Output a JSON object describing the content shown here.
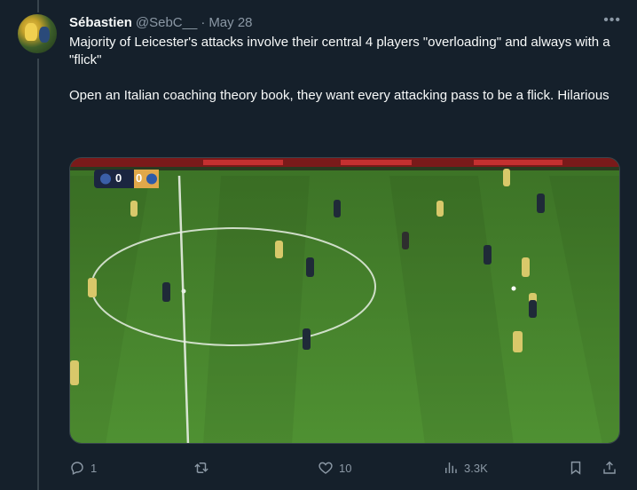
{
  "tweet": {
    "author_name": "Sébastien",
    "handle": "@SebC__",
    "separator": "·",
    "date": "May 28",
    "more_label": "•••",
    "text": "Majority of Leicester's attacks involve their central 4 players \"overloading\" and always with a \"flick\"\n\nOpen an Italian coaching theory book, they want every attacking pass to be a flick. Hilarious"
  },
  "media": {
    "scoreboard": {
      "home_score": "0",
      "away_score": "0"
    }
  },
  "actions": {
    "reply_count": "1",
    "retweet_count": "",
    "like_count": "10",
    "views_count": "3.3K"
  },
  "colors": {
    "background": "#15202b",
    "text_primary": "#f7f9f9",
    "text_secondary": "#8b98a5",
    "pitch_light": "#4a8a2e",
    "pitch_dark": "#3f7a27"
  },
  "icons": [
    "reply-icon",
    "retweet-icon",
    "like-icon",
    "views-icon",
    "bookmark-icon",
    "share-icon"
  ]
}
